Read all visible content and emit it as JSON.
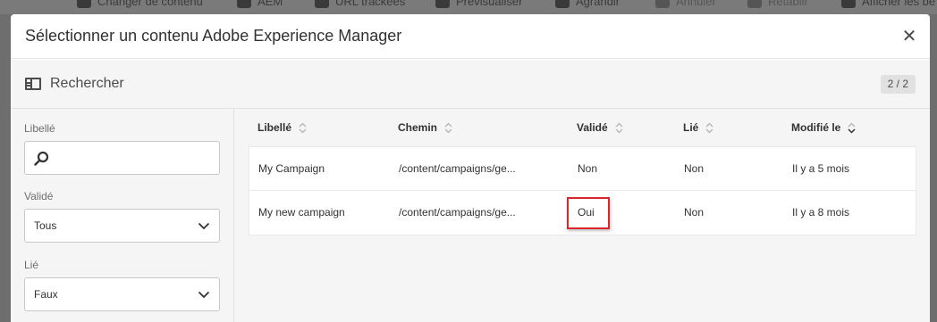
{
  "toolbar": {
    "items": [
      {
        "label": "Changer de contenu",
        "icon": "puzzle-icon"
      },
      {
        "label": "AEM",
        "icon": "aem-icon"
      },
      {
        "label": "URL trackées",
        "icon": "link-icon"
      },
      {
        "label": "Prévisualiser",
        "icon": "eye-icon"
      },
      {
        "label": "Agrandir",
        "icon": "expand-icon"
      },
      {
        "label": "Annuler",
        "icon": "undo-icon"
      },
      {
        "label": "Rétablir",
        "icon": "redo-icon"
      },
      {
        "label": "Afficher les be",
        "icon": "list-icon"
      }
    ]
  },
  "dialog": {
    "title": "Sélectionner un contenu Adobe Experience Manager",
    "close_icon": "close-icon"
  },
  "search": {
    "label": "Rechercher",
    "count": "2 / 2"
  },
  "filters": {
    "libelle_label": "Libellé",
    "valide_label": "Validé",
    "valide_value": "Tous",
    "lie_label": "Lié",
    "lie_value": "Faux"
  },
  "table": {
    "columns": [
      "Libellé",
      "Chemin",
      "Validé",
      "Lié",
      "Modifié le"
    ],
    "rows": [
      {
        "libelle": "My Campaign",
        "chemin": "/content/campaigns/ge...",
        "valide": "Non",
        "lie": "Non",
        "modifie": "Il y a 5 mois"
      },
      {
        "libelle": "My new campaign",
        "chemin": "/content/campaigns/ge...",
        "valide": "Oui",
        "lie": "Non",
        "modifie": "Il y a 8 mois"
      }
    ]
  },
  "colors": {
    "highlight": "#d9262a",
    "rail_bg": "#f5f5f5"
  }
}
